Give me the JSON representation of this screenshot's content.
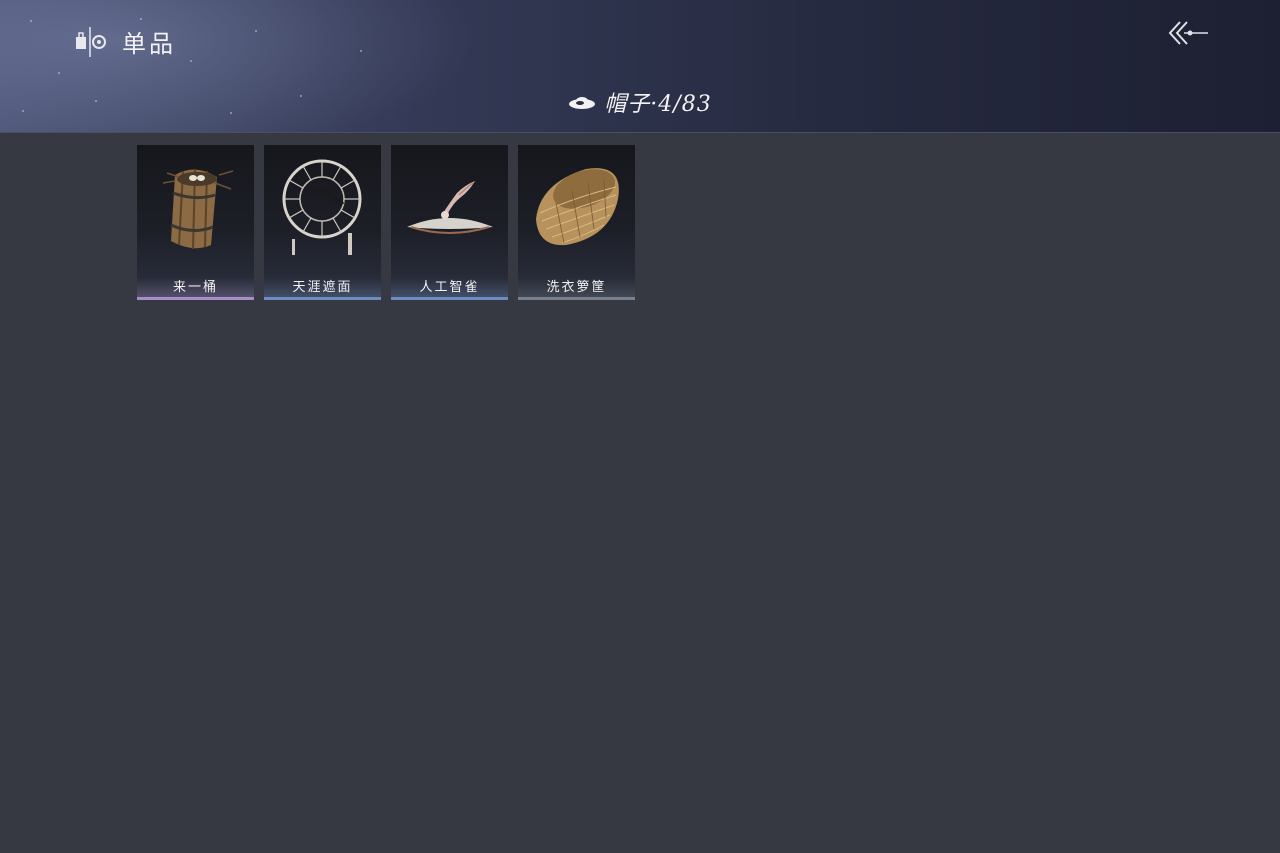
{
  "header": {
    "title": "单品",
    "logo_icon": "wardrobe-emblem-icon",
    "back_icon": "back-arrow-icon"
  },
  "category": {
    "icon": "hat-icon",
    "label": "帽子·4/83"
  },
  "items": [
    {
      "name": "来一桶",
      "icon": "wooden-bucket-icon",
      "rarity_color": "#a88ec8"
    },
    {
      "name": "天涯遮面",
      "icon": "veiled-round-hat-icon",
      "rarity_color": "#6e8cc0"
    },
    {
      "name": "人工智雀",
      "icon": "bird-hat-icon",
      "rarity_color": "#6e8cc0"
    },
    {
      "name": "洗衣箩筐",
      "icon": "wicker-basket-icon",
      "rarity_color": "#7a7f8c"
    }
  ]
}
